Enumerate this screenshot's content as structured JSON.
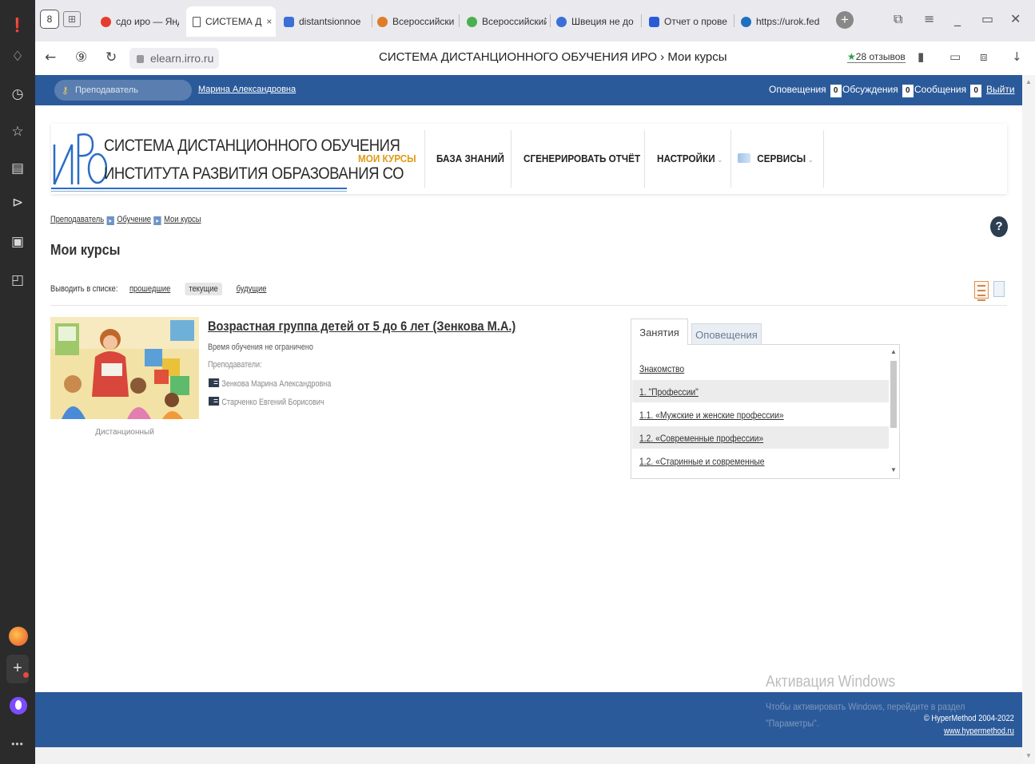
{
  "browser": {
    "tabs": [
      {
        "label": "сдо иро — Янд",
        "color": "#e63b2e"
      },
      {
        "label": "СИСТЕМА Д",
        "color": "#555555"
      },
      {
        "label": "distantsionnoe",
        "color": "#3a6fd8"
      },
      {
        "label": "Всероссийский",
        "color": "#e07b28"
      },
      {
        "label": "Всероссийский",
        "color": "#4caf50"
      },
      {
        "label": "Швеция не до",
        "color": "#3a6fd8"
      },
      {
        "label": "Отчет о прове",
        "color": "#2a5bd7"
      },
      {
        "label": "https://urok.fed",
        "color": "#1f6fbf"
      }
    ],
    "active_tab_close": "×",
    "domain": "elearn.irro.ru",
    "page_title": "СИСТЕМА ДИСТАНЦИОННОГО ОБУЧЕНИЯ ИРО › Мои курсы",
    "reviews": "28 отзывов"
  },
  "topbar": {
    "role": "Преподаватель",
    "user": "Марина Александровна",
    "notifications_label": "Оповещения",
    "notifications_count": "0",
    "discussions_label": "Обсуждения",
    "discussions_count": "0",
    "messages_label": "Сообщения",
    "messages_count": "0",
    "logout": "Выйти"
  },
  "logo": {
    "line1": "СИСТЕМА ДИСТАНЦИОННОГО ОБУЧЕНИЯ",
    "line2": "ИНСТИТУТА РАЗВИТИЯ ОБРАЗОВАНИЯ СО"
  },
  "menu": {
    "my_courses": "МОИ КУРСЫ",
    "knowledge_base": "БАЗА ЗНАНИЙ",
    "generate_report": "СГЕНЕРИРОВАТЬ ОТЧЁТ",
    "settings": "НАСТРОЙКИ",
    "services": "СЕРВИСЫ",
    "accent_color": "#e09a14"
  },
  "breadcrumbs": [
    "Преподаватель",
    "Обучение",
    "Мои курсы"
  ],
  "page": {
    "title": "Мои курсы",
    "filter_label": "Выводить в списке:",
    "filter_past": "прошедшие",
    "filter_current": "текущие",
    "filter_future": "будущие"
  },
  "course": {
    "title": "Возрастная группа детей от 5 до 6 лет (Зенкова М.А.)",
    "time": "Время обучения не ограничено",
    "teachers_label": "Преподаватели:",
    "teachers": [
      "Зенкова Марина Александровна",
      "Старченко Евгений Борисович"
    ],
    "type": "Дистанционный"
  },
  "lessons_panel": {
    "tab_lessons": "Занятия",
    "tab_notifications": "Оповещения",
    "items": [
      "Знакомство",
      "1. \"Профессии\"",
      "1.1. «Мужские и женские профессии»",
      "1.2. «Современные профессии»",
      "1.2. «Старинные и современные"
    ]
  },
  "footer": {
    "copyright": "© HyperMethod 2004-2022",
    "link": "www.hypermethod.ru",
    "color": "#2b5a9a"
  },
  "watermark": {
    "title": "Активация Windows",
    "line1": "Чтобы активировать Windows, перейдите в раздел",
    "line2": "\"Параметры\"."
  }
}
